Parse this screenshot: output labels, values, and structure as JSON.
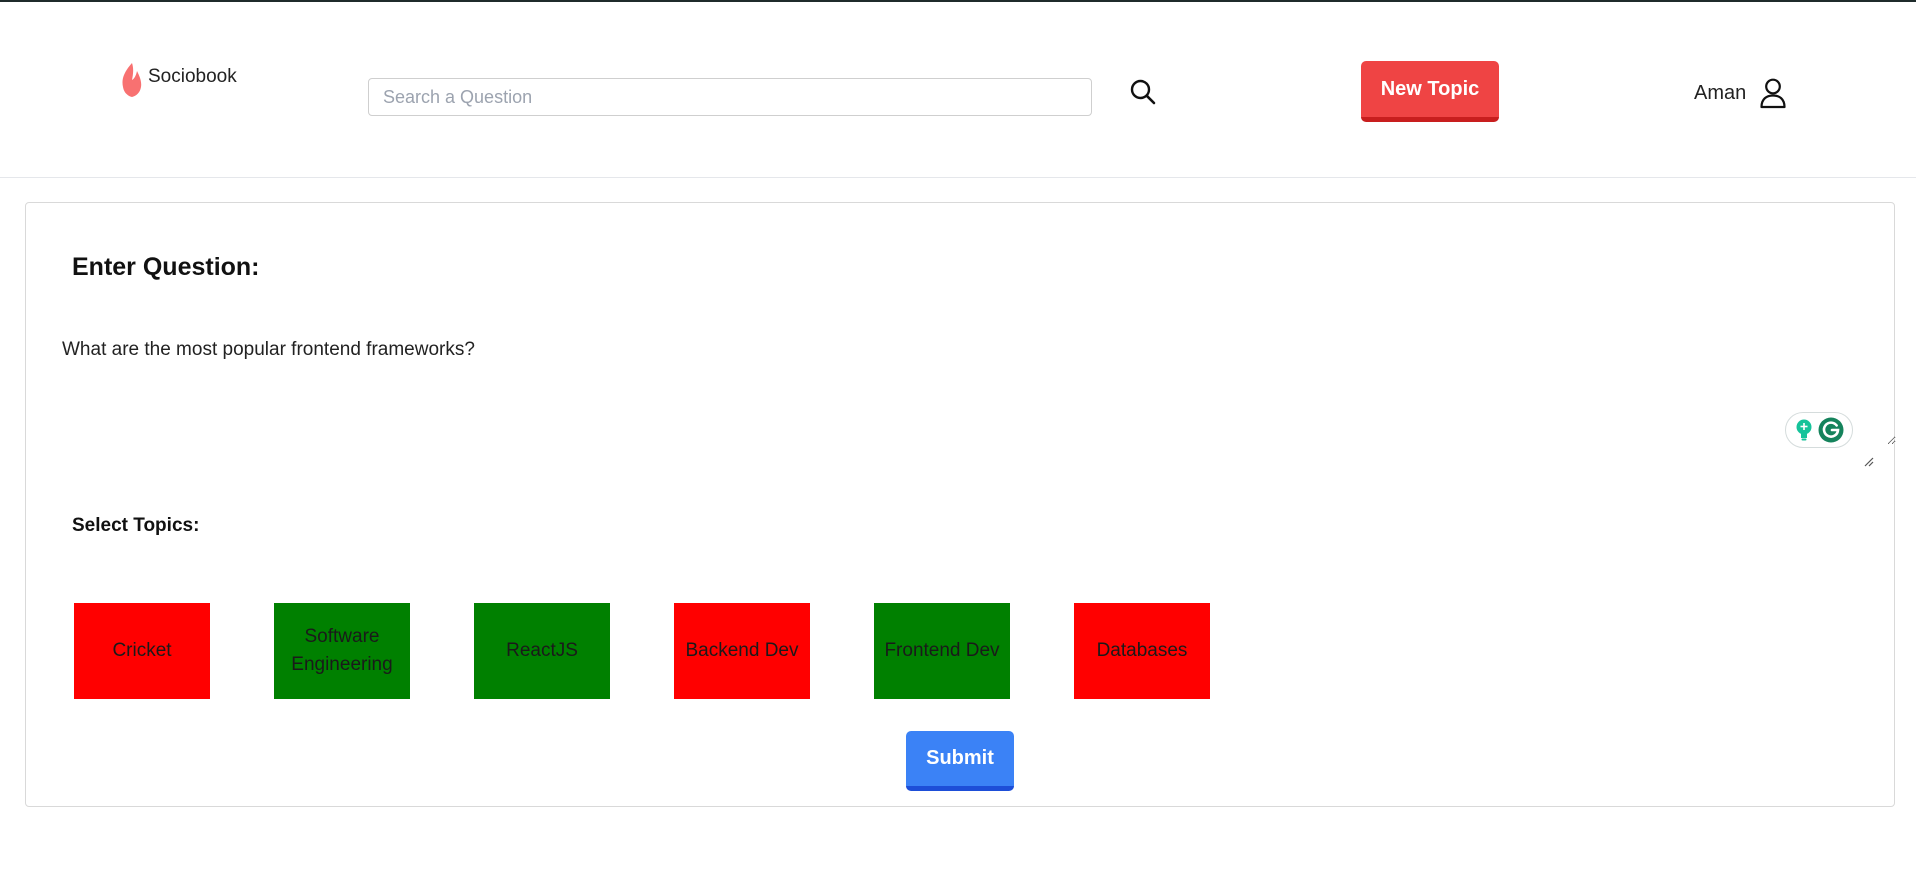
{
  "app": {
    "name": "Sociobook"
  },
  "header": {
    "search_placeholder": "Search a Question",
    "search_icon": "search-icon",
    "new_topic_label": "New Topic",
    "user_name": "Aman",
    "user_icon": "user-icon"
  },
  "form": {
    "title": "Enter Question:",
    "question_value": "What are the most popular frontend frameworks?",
    "topics_label": "Select Topics:",
    "topics": [
      {
        "label": "Cricket",
        "selected": false
      },
      {
        "label": "Software Engineering",
        "selected": true
      },
      {
        "label": "ReactJS",
        "selected": true
      },
      {
        "label": "Backend Dev",
        "selected": false
      },
      {
        "label": "Frontend Dev",
        "selected": true
      },
      {
        "label": "Databases",
        "selected": false
      }
    ],
    "submit_label": "Submit"
  },
  "colors": {
    "selected": "#008000",
    "unselected": "#ff0000",
    "new_topic": "#ef4444",
    "submit": "#3b82f6",
    "logo": "#f87171",
    "grammarly": "#15c39a"
  }
}
